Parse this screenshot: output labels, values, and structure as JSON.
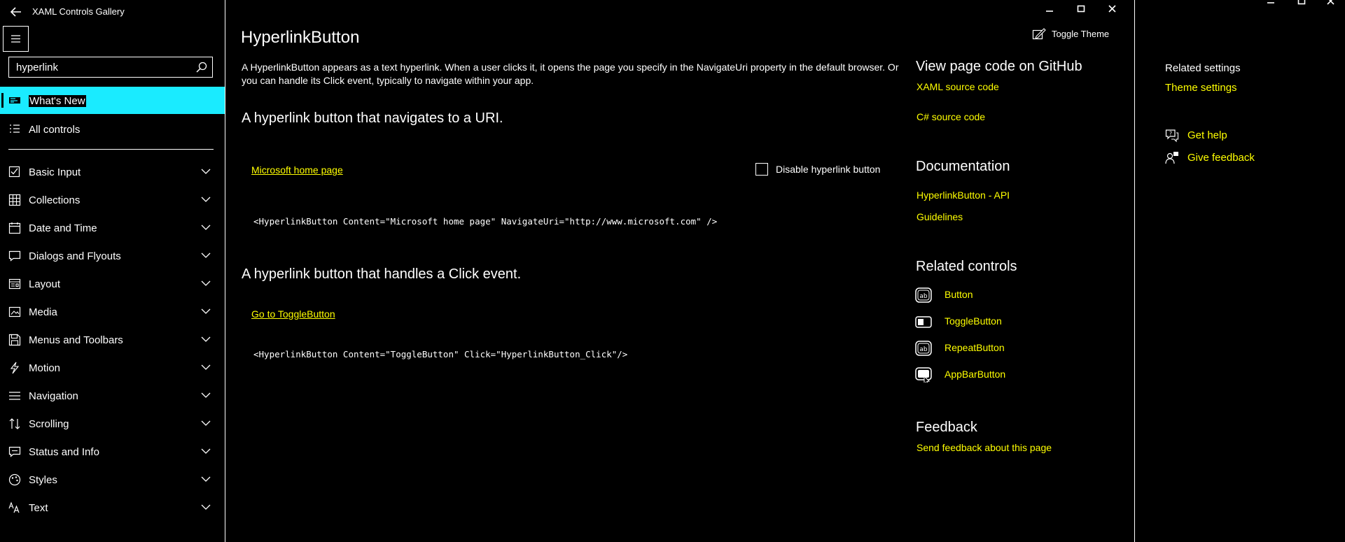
{
  "app": {
    "title": "XAML Controls Gallery"
  },
  "search": {
    "value": "hyperlink",
    "placeholder": "Search"
  },
  "nav": {
    "whats_new": "What's New",
    "all_controls": "All controls",
    "items": [
      {
        "label": "Basic Input",
        "icon": "checkbox-icon"
      },
      {
        "label": "Collections",
        "icon": "grid-icon"
      },
      {
        "label": "Date and Time",
        "icon": "calendar-icon"
      },
      {
        "label": "Dialogs and Flyouts",
        "icon": "chat-bubble-icon"
      },
      {
        "label": "Layout",
        "icon": "layout-icon"
      },
      {
        "label": "Media",
        "icon": "media-icon"
      },
      {
        "label": "Menus and Toolbars",
        "icon": "save-icon"
      },
      {
        "label": "Motion",
        "icon": "lightning-icon"
      },
      {
        "label": "Navigation",
        "icon": "menu-lines-icon"
      },
      {
        "label": "Scrolling",
        "icon": "scroll-arrows-icon"
      },
      {
        "label": "Status and Info",
        "icon": "status-bubble-icon"
      },
      {
        "label": "Styles",
        "icon": "palette-icon"
      },
      {
        "label": "Text",
        "icon": "font-icon"
      }
    ]
  },
  "main": {
    "title": "HyperlinkButton",
    "toggle_theme": "Toggle Theme",
    "description": "A HyperlinkButton appears as a text hyperlink. When a user clicks it, it opens the page you specify in the NavigateUri property in the default browser. Or you can handle its Click event, typically to navigate within your app.",
    "example1": {
      "heading": "A hyperlink button that navigates to a URI.",
      "link": "Microsoft home page",
      "checkbox_label": "Disable hyperlink button",
      "code": "<HyperlinkButton Content=\"Microsoft home page\" NavigateUri=\"http://www.microsoft.com\" />"
    },
    "example2": {
      "heading": "A hyperlink button that handles a Click event.",
      "link": "Go to ToggleButton",
      "code": "<HyperlinkButton Content=\"ToggleButton\" Click=\"HyperlinkButton_Click\"/>"
    }
  },
  "right": {
    "github_heading": "View page code on GitHub",
    "xaml_source": "XAML source code",
    "cs_source": "C# source code",
    "doc_heading": "Documentation",
    "api_link": "HyperlinkButton - API",
    "guidelines": "Guidelines",
    "related_heading": "Related controls",
    "related": [
      {
        "label": "Button",
        "icon": "button-icon"
      },
      {
        "label": "ToggleButton",
        "icon": "toggle-switch-icon"
      },
      {
        "label": "RepeatButton",
        "icon": "button-icon"
      },
      {
        "label": "AppBarButton",
        "icon": "appbar-button-icon"
      }
    ],
    "feedback_heading": "Feedback",
    "send_feedback": "Send feedback about this page"
  },
  "settings": {
    "heading": "Related settings",
    "theme": "Theme settings",
    "get_help": "Get help",
    "give_feedback": "Give feedback"
  },
  "colors": {
    "link": "#ffff00",
    "selection": "#1aebff",
    "background": "#000000",
    "text": "#ffffff"
  }
}
